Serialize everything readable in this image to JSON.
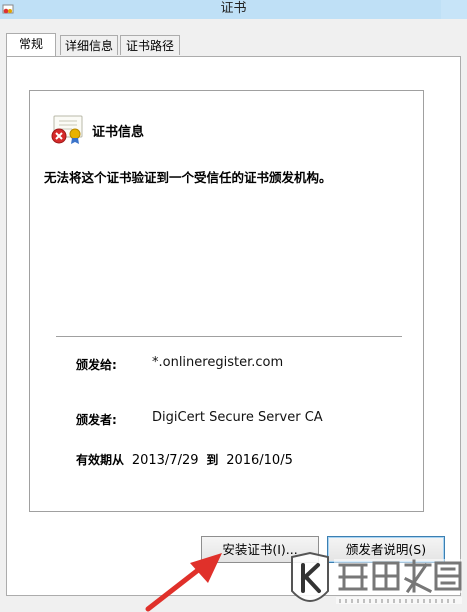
{
  "window": {
    "title": "证书"
  },
  "tabs": [
    {
      "label": "常规",
      "active": true
    },
    {
      "label": "详细信息",
      "active": false
    },
    {
      "label": "证书路径",
      "active": false
    }
  ],
  "certificate": {
    "heading": "证书信息",
    "warning": "无法将这个证书验证到一个受信任的证书颁发机构。",
    "issued_to_label": "颁发给:",
    "issued_to": "*.onlineregister.com",
    "issued_by_label": "颁发者:",
    "issued_by": "DigiCert Secure Server CA",
    "validity_label": "有效期从",
    "valid_from": "2013/7/29",
    "validity_to_word": "到",
    "valid_to": "2016/10/5"
  },
  "buttons": {
    "install": "安装证书(I)...",
    "issuer_statement": "颁发者说明(S)"
  },
  "colors": {
    "titlebar": "#bfe0f6",
    "arrow": "#e0302a",
    "default_button_border": "#3c7fb1"
  }
}
